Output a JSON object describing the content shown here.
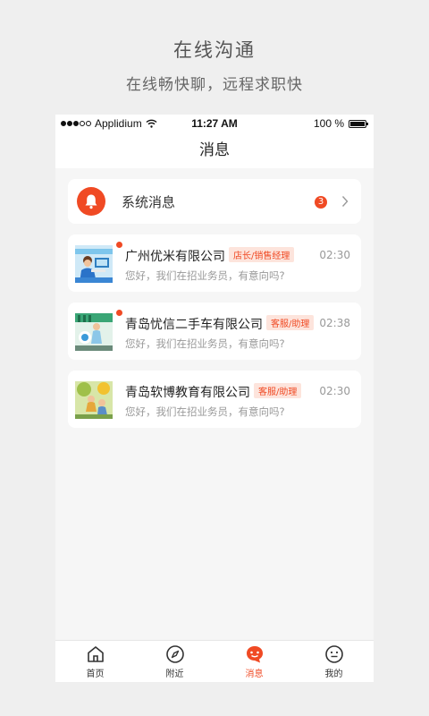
{
  "promo": {
    "title": "在线沟通",
    "subtitle": "在线畅快聊，远程求职快"
  },
  "status_bar": {
    "carrier": "Applidium",
    "time": "11:27 AM",
    "battery": "100 %",
    "battery_level": 1.0
  },
  "nav": {
    "title": "消息"
  },
  "system_messages": {
    "label": "系统消息",
    "unread_count": "3"
  },
  "messages": [
    {
      "company": "广州优米有限公司",
      "tag": "店长/销售经理",
      "time": "02:30",
      "preview": "您好，我们在招业务员，有意向吗?",
      "unread": true
    },
    {
      "company": "青岛忧信二手车有限公司",
      "tag": "客服/助理",
      "time": "02:38",
      "preview": "您好，我们在招业务员，有意向吗?",
      "unread": true
    },
    {
      "company": "青岛软博教育有限公司",
      "tag": "客服/助理",
      "time": "02:30",
      "preview": "您好，我们在招业务员，有意向吗?",
      "unread": false
    }
  ],
  "tabs": [
    {
      "label": "首页",
      "icon": "home-icon",
      "active": false
    },
    {
      "label": "附近",
      "icon": "compass-icon",
      "active": false
    },
    {
      "label": "消息",
      "icon": "chat-icon",
      "active": true
    },
    {
      "label": "我的",
      "icon": "smiley-icon",
      "active": false
    }
  ],
  "colors": {
    "accent": "#f04a24",
    "tag_bg": "#fde4dc",
    "page_bg": "#efefef",
    "list_bg": "#f6f6f6"
  }
}
